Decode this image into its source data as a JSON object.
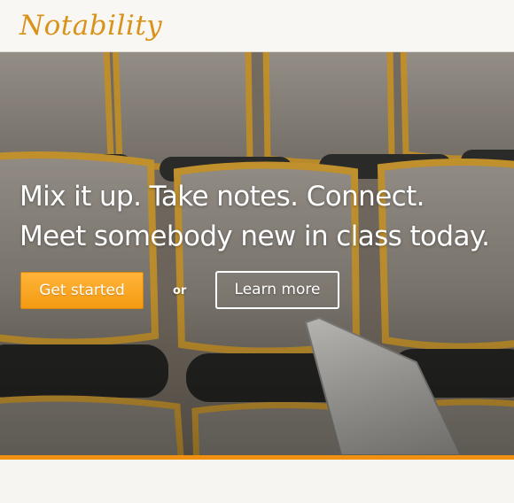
{
  "header": {
    "logo_text": "Notability"
  },
  "hero": {
    "headline_line1": "Mix it up. Take notes. Connect.",
    "headline_line2": "Meet somebody new in class today.",
    "primary_cta_label": "Get started",
    "separator_text": "or",
    "secondary_cta_label": "Learn more"
  },
  "colors": {
    "brand": "#d9921a",
    "cta": "#f49a12",
    "accent_bar": "#f08f10"
  }
}
